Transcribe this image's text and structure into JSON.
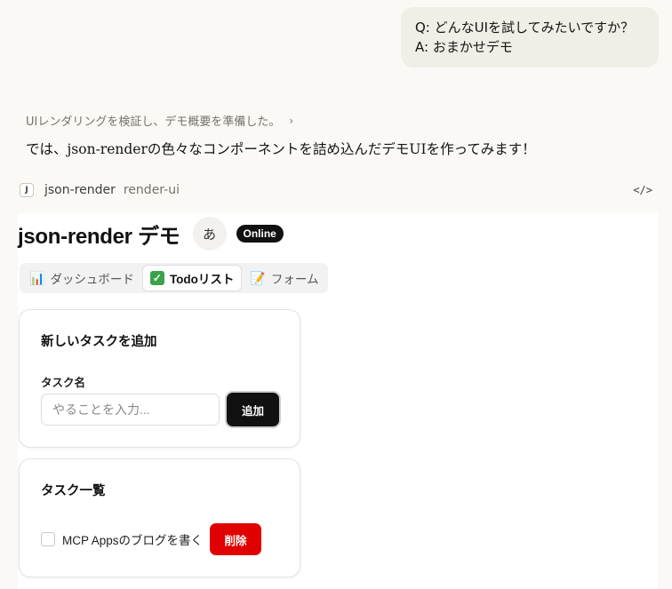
{
  "user_message": {
    "question": "Q: どんなUIを試してみたいですか？",
    "answer": "A: おまかせデモ"
  },
  "assistant": {
    "thinking_summary": "UIレンダリングを検証し、デモ概要を準備した。",
    "reply": "では、json-renderの色々なコンポーネントを詰め込んだデモUIを作ってみます！"
  },
  "artifact": {
    "icon_letter": "J",
    "name": "json-render",
    "type": "render-ui",
    "code_toggle": "</>"
  },
  "app": {
    "title": "json-render デモ",
    "avatar_text": "あ",
    "status_badge": "Online",
    "tabs": [
      {
        "icon": "📊",
        "label": "ダッシュボード",
        "active": false
      },
      {
        "icon": "✓",
        "label": "Todoリスト",
        "active": true
      },
      {
        "icon": "📝",
        "label": "フォーム",
        "active": false
      }
    ],
    "add_card": {
      "title": "新しいタスクを追加",
      "field_label": "タスク名",
      "input_value": "",
      "input_placeholder": "やることを入力...",
      "add_button": "追加"
    },
    "list_card": {
      "title": "タスク一覧",
      "items": [
        {
          "text": "MCP Appsのブログを書く",
          "done": false,
          "delete_label": "削除"
        }
      ]
    }
  },
  "colors": {
    "page_bg": "#faf9f5",
    "bubble_bg": "#f0eee6",
    "primary_button": "#111111",
    "danger_button": "#e00000",
    "todo_check_green": "#3aa34a"
  }
}
